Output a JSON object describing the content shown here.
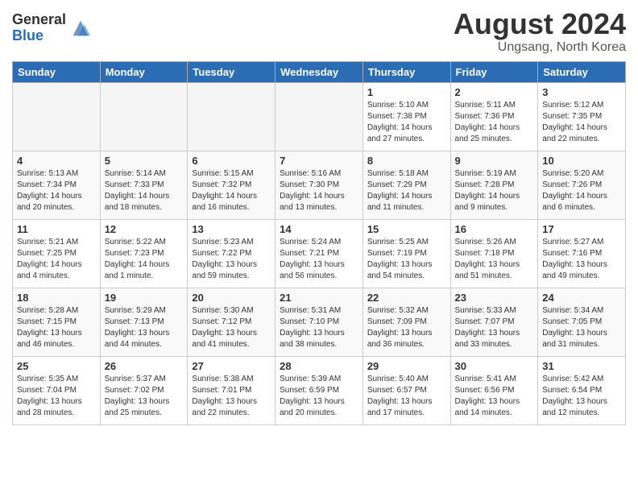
{
  "logo": {
    "general": "General",
    "blue": "Blue"
  },
  "title": {
    "month_year": "August 2024",
    "location": "Ungsang, North Korea"
  },
  "weekdays": [
    "Sunday",
    "Monday",
    "Tuesday",
    "Wednesday",
    "Thursday",
    "Friday",
    "Saturday"
  ],
  "weeks": [
    [
      {
        "day": "",
        "info": ""
      },
      {
        "day": "",
        "info": ""
      },
      {
        "day": "",
        "info": ""
      },
      {
        "day": "",
        "info": ""
      },
      {
        "day": "1",
        "info": "Sunrise: 5:10 AM\nSunset: 7:38 PM\nDaylight: 14 hours\nand 27 minutes."
      },
      {
        "day": "2",
        "info": "Sunrise: 5:11 AM\nSunset: 7:36 PM\nDaylight: 14 hours\nand 25 minutes."
      },
      {
        "day": "3",
        "info": "Sunrise: 5:12 AM\nSunset: 7:35 PM\nDaylight: 14 hours\nand 22 minutes."
      }
    ],
    [
      {
        "day": "4",
        "info": "Sunrise: 5:13 AM\nSunset: 7:34 PM\nDaylight: 14 hours\nand 20 minutes."
      },
      {
        "day": "5",
        "info": "Sunrise: 5:14 AM\nSunset: 7:33 PM\nDaylight: 14 hours\nand 18 minutes."
      },
      {
        "day": "6",
        "info": "Sunrise: 5:15 AM\nSunset: 7:32 PM\nDaylight: 14 hours\nand 16 minutes."
      },
      {
        "day": "7",
        "info": "Sunrise: 5:16 AM\nSunset: 7:30 PM\nDaylight: 14 hours\nand 13 minutes."
      },
      {
        "day": "8",
        "info": "Sunrise: 5:18 AM\nSunset: 7:29 PM\nDaylight: 14 hours\nand 11 minutes."
      },
      {
        "day": "9",
        "info": "Sunrise: 5:19 AM\nSunset: 7:28 PM\nDaylight: 14 hours\nand 9 minutes."
      },
      {
        "day": "10",
        "info": "Sunrise: 5:20 AM\nSunset: 7:26 PM\nDaylight: 14 hours\nand 6 minutes."
      }
    ],
    [
      {
        "day": "11",
        "info": "Sunrise: 5:21 AM\nSunset: 7:25 PM\nDaylight: 14 hours\nand 4 minutes."
      },
      {
        "day": "12",
        "info": "Sunrise: 5:22 AM\nSunset: 7:23 PM\nDaylight: 14 hours\nand 1 minute."
      },
      {
        "day": "13",
        "info": "Sunrise: 5:23 AM\nSunset: 7:22 PM\nDaylight: 13 hours\nand 59 minutes."
      },
      {
        "day": "14",
        "info": "Sunrise: 5:24 AM\nSunset: 7:21 PM\nDaylight: 13 hours\nand 56 minutes."
      },
      {
        "day": "15",
        "info": "Sunrise: 5:25 AM\nSunset: 7:19 PM\nDaylight: 13 hours\nand 54 minutes."
      },
      {
        "day": "16",
        "info": "Sunrise: 5:26 AM\nSunset: 7:18 PM\nDaylight: 13 hours\nand 51 minutes."
      },
      {
        "day": "17",
        "info": "Sunrise: 5:27 AM\nSunset: 7:16 PM\nDaylight: 13 hours\nand 49 minutes."
      }
    ],
    [
      {
        "day": "18",
        "info": "Sunrise: 5:28 AM\nSunset: 7:15 PM\nDaylight: 13 hours\nand 46 minutes."
      },
      {
        "day": "19",
        "info": "Sunrise: 5:29 AM\nSunset: 7:13 PM\nDaylight: 13 hours\nand 44 minutes."
      },
      {
        "day": "20",
        "info": "Sunrise: 5:30 AM\nSunset: 7:12 PM\nDaylight: 13 hours\nand 41 minutes."
      },
      {
        "day": "21",
        "info": "Sunrise: 5:31 AM\nSunset: 7:10 PM\nDaylight: 13 hours\nand 38 minutes."
      },
      {
        "day": "22",
        "info": "Sunrise: 5:32 AM\nSunset: 7:09 PM\nDaylight: 13 hours\nand 36 minutes."
      },
      {
        "day": "23",
        "info": "Sunrise: 5:33 AM\nSunset: 7:07 PM\nDaylight: 13 hours\nand 33 minutes."
      },
      {
        "day": "24",
        "info": "Sunrise: 5:34 AM\nSunset: 7:05 PM\nDaylight: 13 hours\nand 31 minutes."
      }
    ],
    [
      {
        "day": "25",
        "info": "Sunrise: 5:35 AM\nSunset: 7:04 PM\nDaylight: 13 hours\nand 28 minutes."
      },
      {
        "day": "26",
        "info": "Sunrise: 5:37 AM\nSunset: 7:02 PM\nDaylight: 13 hours\nand 25 minutes."
      },
      {
        "day": "27",
        "info": "Sunrise: 5:38 AM\nSunset: 7:01 PM\nDaylight: 13 hours\nand 22 minutes."
      },
      {
        "day": "28",
        "info": "Sunrise: 5:39 AM\nSunset: 6:59 PM\nDaylight: 13 hours\nand 20 minutes."
      },
      {
        "day": "29",
        "info": "Sunrise: 5:40 AM\nSunset: 6:57 PM\nDaylight: 13 hours\nand 17 minutes."
      },
      {
        "day": "30",
        "info": "Sunrise: 5:41 AM\nSunset: 6:56 PM\nDaylight: 13 hours\nand 14 minutes."
      },
      {
        "day": "31",
        "info": "Sunrise: 5:42 AM\nSunset: 6:54 PM\nDaylight: 13 hours\nand 12 minutes."
      }
    ]
  ]
}
